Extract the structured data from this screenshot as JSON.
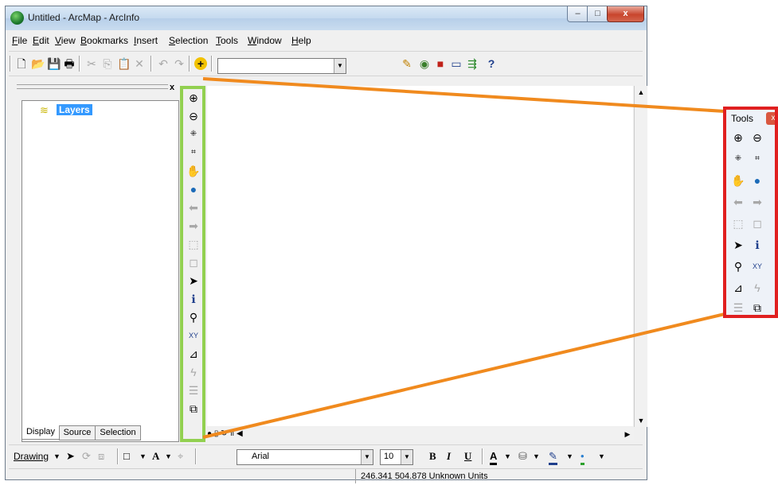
{
  "window": {
    "title": "Untitled - ArcMap - ArcInfo",
    "min_label": "–",
    "max_label": "□",
    "close_label": "x"
  },
  "menu": [
    {
      "label": "File",
      "accel": "F",
      "rest": "ile"
    },
    {
      "label": "Edit",
      "accel": "E",
      "rest": "dit"
    },
    {
      "label": "View",
      "accel": "V",
      "rest": "iew"
    },
    {
      "label": "Bookmarks",
      "accel": "B",
      "rest": "ookmarks"
    },
    {
      "label": "Insert",
      "accel": "I",
      "rest": "nsert"
    },
    {
      "label": "Selection",
      "accel": "S",
      "rest": "election"
    },
    {
      "label": "Tools",
      "accel": "T",
      "rest": "ools"
    },
    {
      "label": "Window",
      "accel": "W",
      "rest": "indow"
    },
    {
      "label": "Help",
      "accel": "H",
      "rest": "elp"
    }
  ],
  "toc": {
    "layers_label": "Layers",
    "tabs": [
      "Display",
      "Source",
      "Selection"
    ],
    "close_label": "x"
  },
  "drawing_toolbar": {
    "drawing_label": "Drawing",
    "font_value": "Arial",
    "size_value": "10",
    "bold": "B",
    "italic": "I",
    "underline": "U"
  },
  "status": {
    "coords": "246.341  504.878 Unknown Units"
  },
  "floating_tools": {
    "title": "Tools"
  },
  "colors": {
    "docked_highlight": "#92d050",
    "float_highlight": "#e02020",
    "callout_line": "#f08a1e",
    "selection": "#3399ff"
  },
  "icons": {
    "tools": [
      "zoom-in-icon",
      "zoom-out-icon",
      "fixed-zoom-in-icon",
      "fixed-zoom-out-icon",
      "pan-icon",
      "full-extent-icon",
      "back-icon",
      "forward-icon",
      "select-elements-icon",
      "clear-selection-icon",
      "select-pointer-icon",
      "identify-icon",
      "find-icon",
      "go-to-xy-icon",
      "measure-icon",
      "hyperlink-icon",
      "html-popup-icon",
      "time-slider-icon"
    ]
  }
}
